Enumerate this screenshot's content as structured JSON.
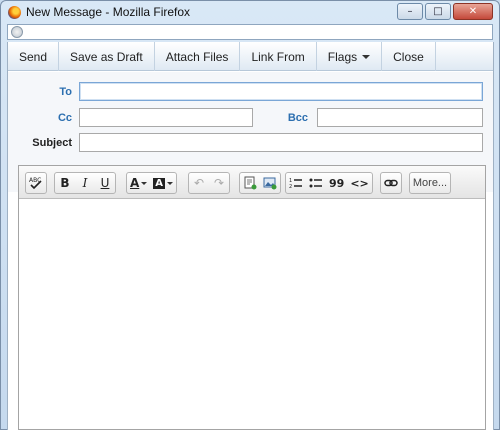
{
  "window": {
    "title": "New Message - Mozilla Firefox"
  },
  "toolbar": {
    "buttons": [
      "Send",
      "Save as Draft",
      "Attach Files",
      "Link From",
      "Flags",
      "Close"
    ]
  },
  "form": {
    "to_label": "To",
    "to_value": "",
    "cc_label": "Cc",
    "cc_value": "",
    "bcc_label": "Bcc",
    "bcc_value": "",
    "subject_label": "Subject",
    "subject_value": ""
  },
  "editor": {
    "more_label": "More...",
    "icons": [
      "spellcheck-icon",
      "bold-icon",
      "italic-icon",
      "underline-icon",
      "font-color-icon",
      "background-color-icon",
      "undo-icon",
      "redo-icon",
      "insert-document-icon",
      "insert-image-icon",
      "numbered-list-icon",
      "bullet-list-icon",
      "blockquote-icon",
      "source-code-icon",
      "link-icon"
    ],
    "bold_glyph": "B",
    "italic_glyph": "I",
    "underline_glyph": "U",
    "color_glyph": "A",
    "quote_glyph": "99",
    "code_glyph": "<>"
  },
  "colors": {
    "label_blue": "#2c6fb0",
    "window_frame": "#c9dcef"
  }
}
